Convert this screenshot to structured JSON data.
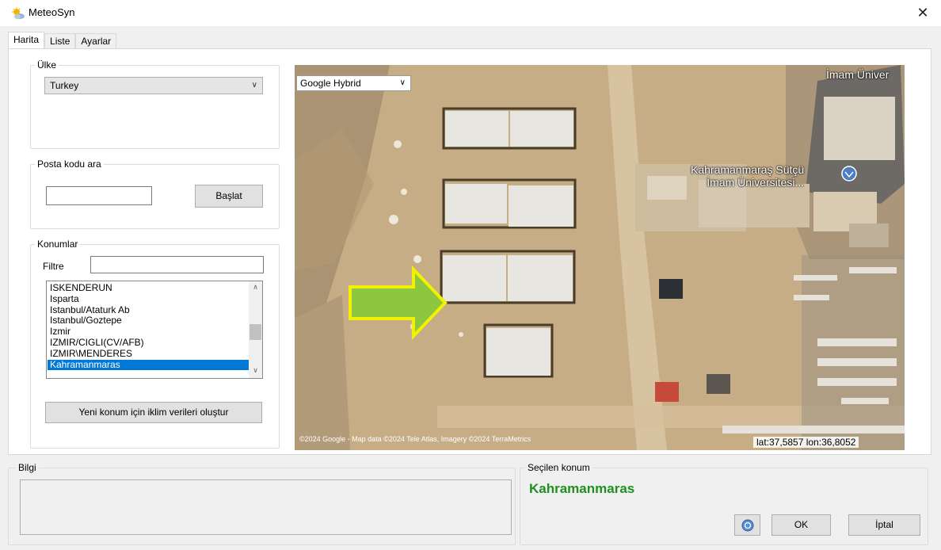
{
  "window": {
    "title": "MeteoSyn",
    "close_symbol": "✕"
  },
  "tabs": [
    {
      "label": "Harita",
      "active": true
    },
    {
      "label": "Liste",
      "active": false
    },
    {
      "label": "Ayarlar",
      "active": false
    }
  ],
  "country": {
    "label": "Ülke",
    "value": "Turkey"
  },
  "postcode": {
    "label": "Posta kodu ara",
    "input_value": "",
    "start_button": "Başlat"
  },
  "locations": {
    "label": "Konumlar",
    "filter_label": "Filtre",
    "filter_value": "",
    "items": [
      "ISKENDERUN",
      "Isparta",
      "Istanbul/Ataturk Ab",
      "Istanbul/Goztepe",
      "Izmir",
      "IZMIR/CIGLI(CV/AFB)",
      "IZMIR\\MENDERES",
      "Kahramanmaras"
    ],
    "selected_index": 7,
    "create_button": "Yeni konum için iklim verileri oluştur"
  },
  "map": {
    "layer": "Google Hybrid",
    "poi_label_line1": "Kahramanmaraş Sütçü",
    "poi_label_line2": "İmam Üniversitesi...",
    "top_right_label": "İmam Üniver",
    "copyright": "©2024 Google - Map data ©2024 Tele Atlas, Imagery ©2024 TerraMetrics",
    "coordinates": "lat:37,5857  lon:36,8052"
  },
  "info": {
    "label": "Bilgi",
    "text": ""
  },
  "selection": {
    "label": "Seçilen konum",
    "value": "Kahramanmaras"
  },
  "footer": {
    "ok": "OK",
    "cancel": "İptal"
  },
  "colors": {
    "accent": "#0078d7",
    "selected_location": "#1f8f1f",
    "arrow_fill": "#8dc63f",
    "arrow_stroke": "#f2f200"
  }
}
